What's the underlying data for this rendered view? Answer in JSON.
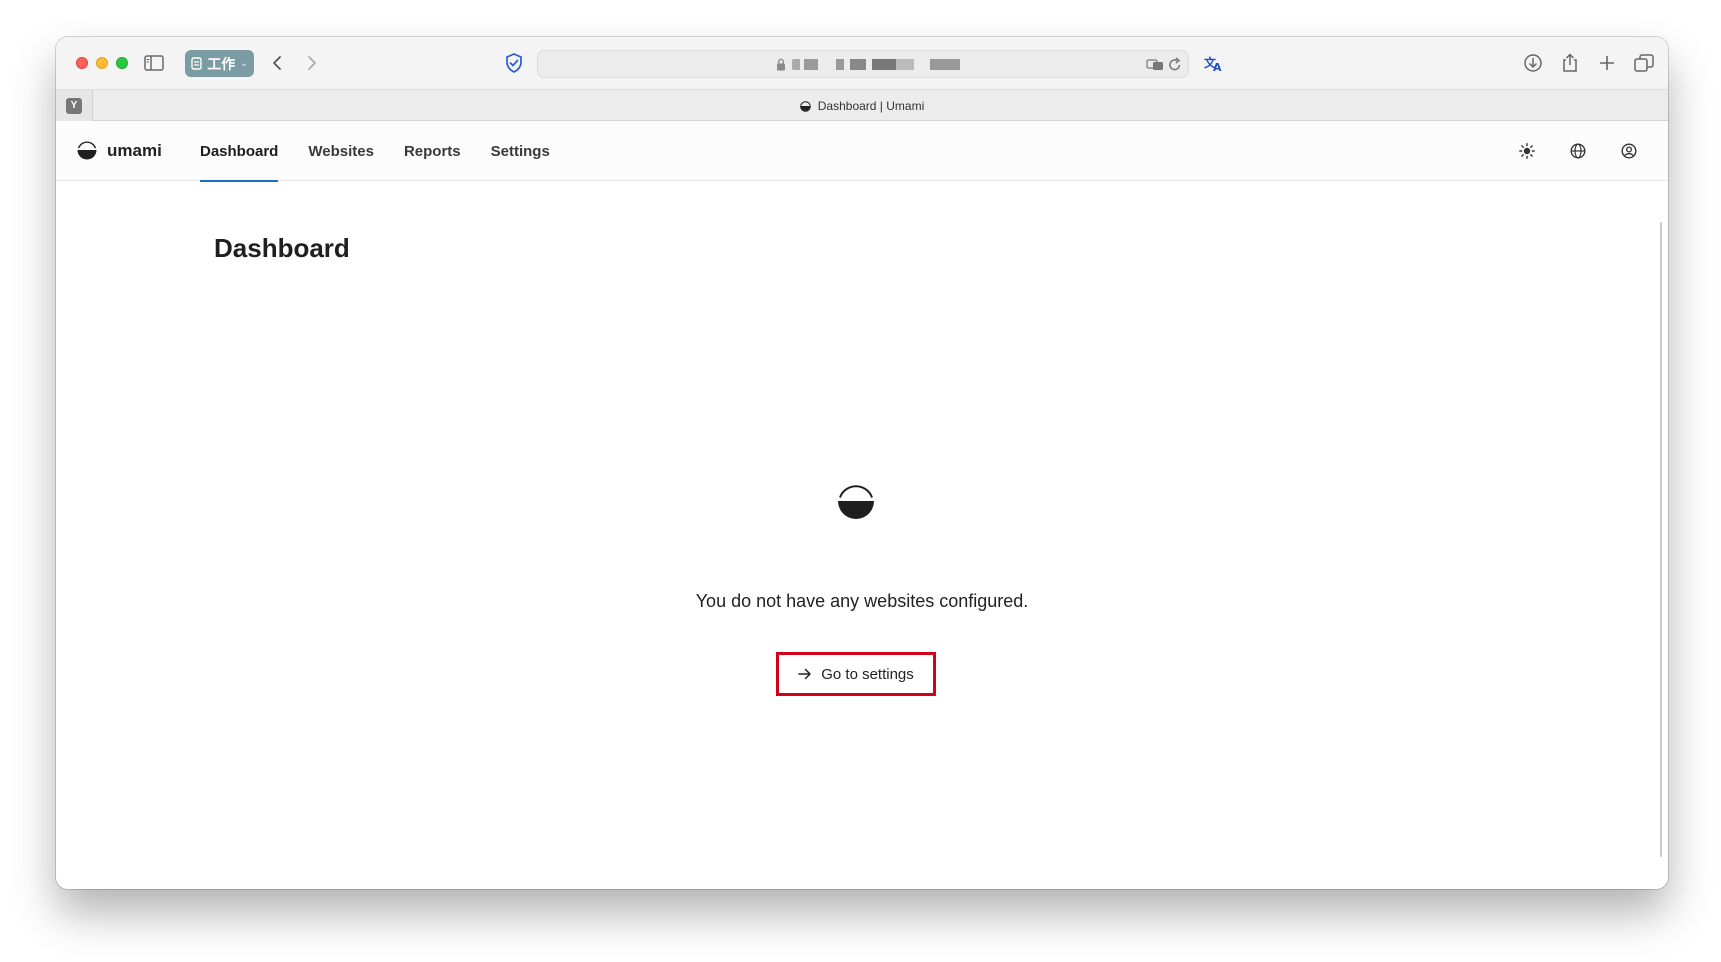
{
  "browser": {
    "tab_group_label": "工作",
    "tab_title": "Dashboard | Umami",
    "pinned_tab_letter": "Y"
  },
  "app": {
    "brand": "umami",
    "nav": [
      {
        "label": "Dashboard",
        "active": true
      },
      {
        "label": "Websites",
        "active": false
      },
      {
        "label": "Reports",
        "active": false
      },
      {
        "label": "Settings",
        "active": false
      }
    ],
    "icons": [
      "theme-icon",
      "language-icon",
      "profile-icon"
    ]
  },
  "main": {
    "title": "Dashboard",
    "empty_message": "You do not have any websites configured.",
    "settings_button_label": "Go to settings"
  },
  "colors": {
    "accent": "#1e6fbf",
    "highlight_border": "#d0021b",
    "tab_group": "#7a9ca2"
  }
}
